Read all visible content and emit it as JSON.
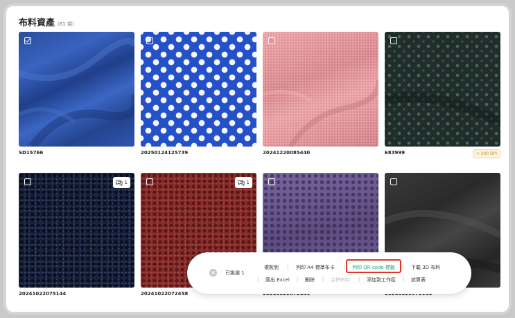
{
  "header": {
    "title": "布料資產",
    "count": "(81 項)"
  },
  "cards": [
    {
      "code": "SD15766",
      "checked": true,
      "comments": null,
      "badge": null
    },
    {
      "code": "20250124125739",
      "checked": false,
      "comments": null,
      "badge": null
    },
    {
      "code": "20241220085440",
      "checked": false,
      "comments": null,
      "badge": null
    },
    {
      "code": "E83999",
      "checked": false,
      "comments": null,
      "badge": "< 300 DPI"
    },
    {
      "code": "20241022075144",
      "checked": false,
      "comments": "1",
      "badge": null
    },
    {
      "code": "20241022072458",
      "checked": false,
      "comments": "1",
      "badge": null
    },
    {
      "code": "20241022072441",
      "checked": false,
      "comments": null,
      "badge": null
    },
    {
      "code": "20241022072144",
      "checked": false,
      "comments": null,
      "badge": null
    }
  ],
  "toolbar": {
    "selected": "已挑選 1",
    "copy_to": "複製到",
    "print_a4": "列印 A4 標準布卡",
    "print_qr": "列印 QR code 標籤",
    "download_3d": "下載 3D 布料",
    "export_excel": "匯出 Excel",
    "delete": "刪除",
    "merge": "合併布料",
    "add_workspace": "添加到工作區",
    "calculator": "試算表",
    "sep": "|"
  },
  "colors": {
    "accent": "#1fa67a",
    "highlight": "#e0352b"
  }
}
